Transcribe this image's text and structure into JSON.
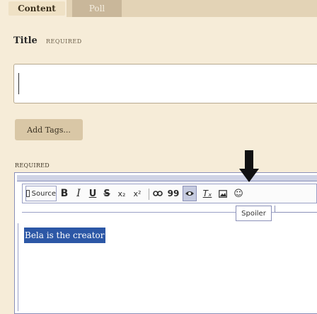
{
  "tabs": [
    {
      "label": "Content",
      "active": true
    },
    {
      "label": "Poll",
      "active": false
    }
  ],
  "title_field": {
    "label": "Title",
    "required_tag": "REQUIRED",
    "value": ""
  },
  "tags": {
    "button_label": "Add Tags..."
  },
  "body_field": {
    "required_tag": "REQUIRED"
  },
  "toolbar": {
    "source_label": "Source",
    "bold": "B",
    "italic": "I",
    "underline": "U",
    "strike": "S",
    "subscript": "x₂",
    "superscript": "x²",
    "link": "∞",
    "quote": "99",
    "remove_format": "Tₓ",
    "image": "▣",
    "emoji": "☺",
    "spoiler_icon": "eye-icon"
  },
  "spoiler_tooltip": "Spoiler",
  "editor": {
    "content_text": "Bela is the creator"
  },
  "colors": {
    "background": "#f6ecd8",
    "selection": "#2c57a6",
    "annotation_arrow": "#111111"
  }
}
